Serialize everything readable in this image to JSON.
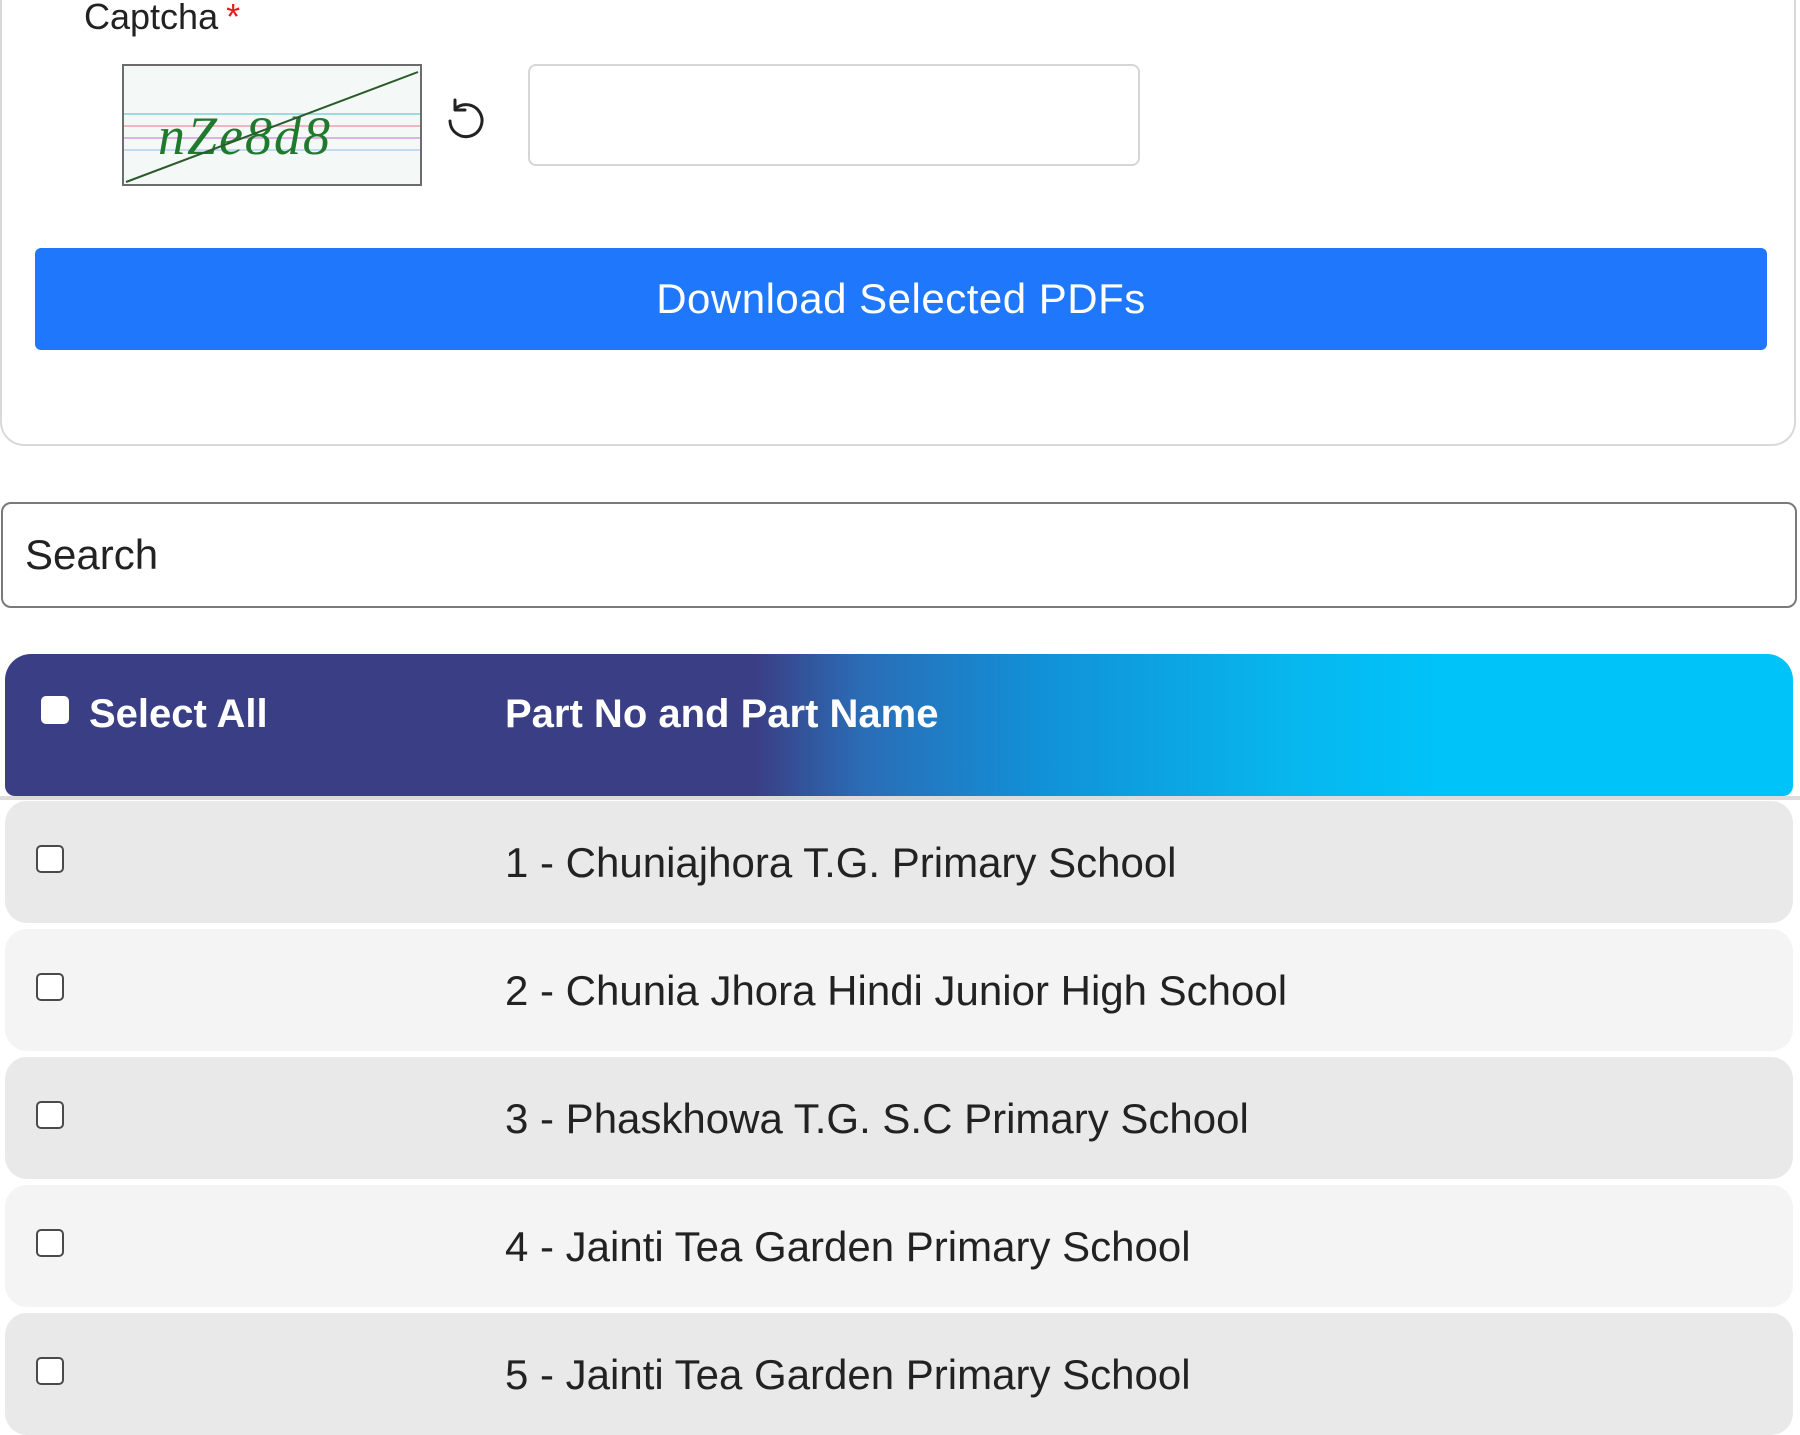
{
  "captcha": {
    "label": "Captcha",
    "required_mark": "*",
    "image_text": "nZe8d8",
    "input_value": "",
    "refresh_icon": "refresh-icon"
  },
  "actions": {
    "download_label": "Download Selected PDFs"
  },
  "search": {
    "placeholder": "Search",
    "value": ""
  },
  "table": {
    "header": {
      "select_all_label": "Select All",
      "part_column_label": "Part No and Part Name"
    },
    "rows": [
      {
        "label": "1 - Chuniajhora T.G. Primary School",
        "checked": false
      },
      {
        "label": "2 - Chunia Jhora Hindi Junior High School",
        "checked": false
      },
      {
        "label": "3 - Phaskhowa T.G. S.C Primary School",
        "checked": false
      },
      {
        "label": "4 - Jainti Tea Garden Primary School",
        "checked": false
      },
      {
        "label": "5 - Jainti Tea Garden Primary School",
        "checked": false
      }
    ]
  },
  "colors": {
    "primary_button": "#1f78fb",
    "header_start": "#3a3f85",
    "header_end": "#00c3f9",
    "required": "#e11d1d"
  }
}
